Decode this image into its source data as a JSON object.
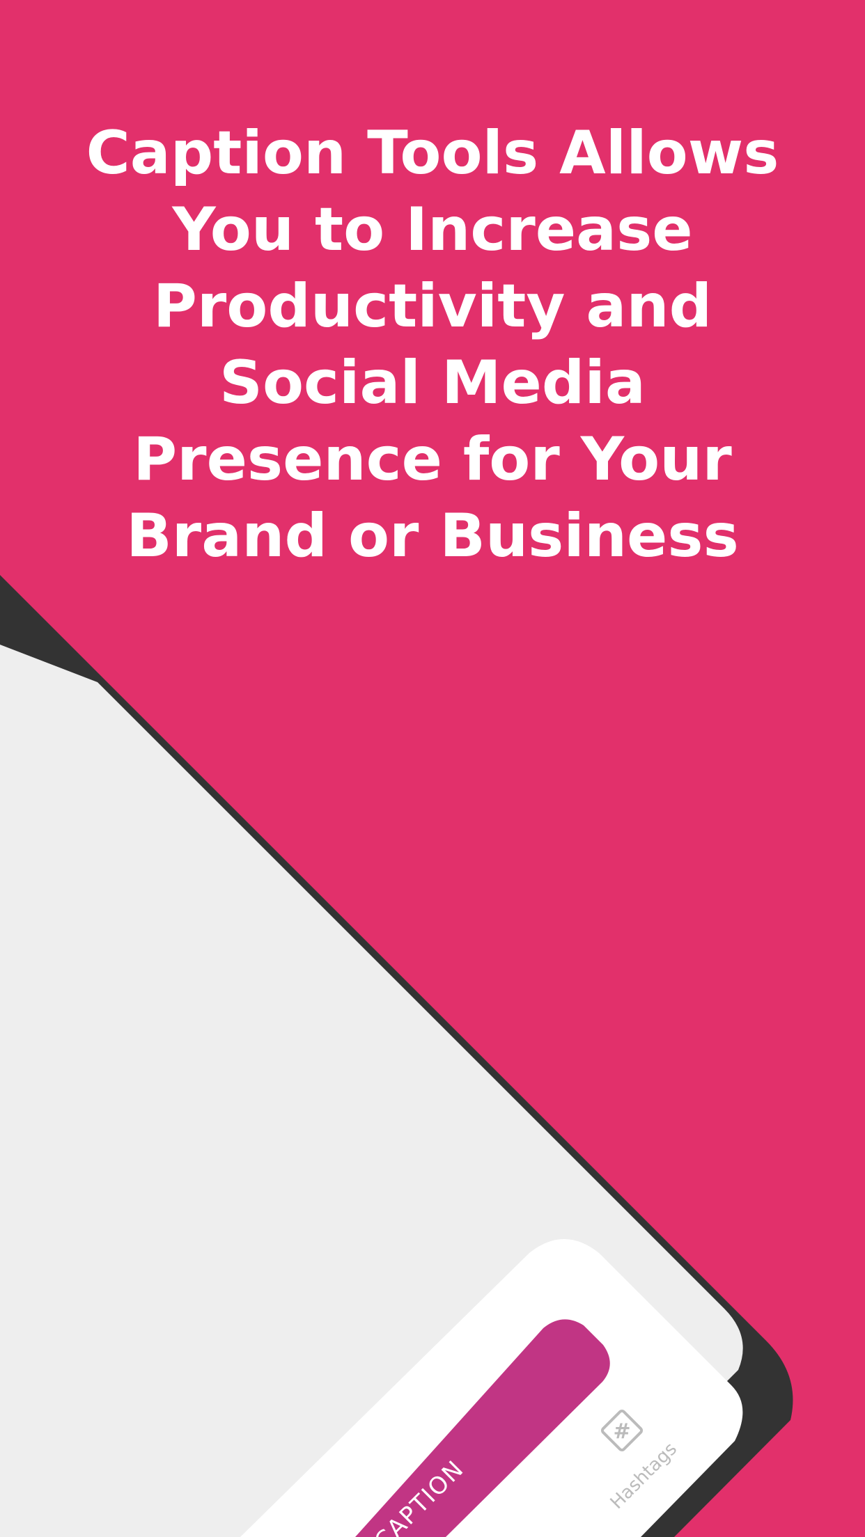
{
  "headline": {
    "lines": [
      "Caption Tools Allows",
      "You to Increase",
      "Productivity and",
      "Social Media",
      "Presence for Your",
      "Brand or Business"
    ]
  },
  "tab_bar": {
    "active_tab_label": "CAPTION",
    "hashtags_label": "Hashtags",
    "hashtags_icon": "hashtag-icon"
  },
  "colors": {
    "background": "#E2306B",
    "phone_frame": "#333333",
    "screen": "#EEEEEE",
    "tab_bar": "#FFFFFF",
    "active_tab": "#C13584",
    "inactive_label": "#BBBBBB"
  }
}
